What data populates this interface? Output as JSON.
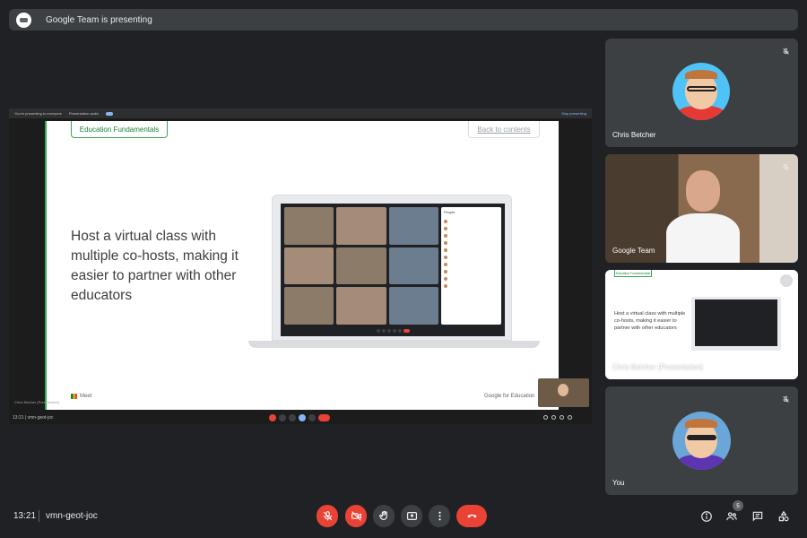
{
  "banner": {
    "text": "Google Team is presenting"
  },
  "stage": {
    "top_bar_left": "You're presenting to everyone",
    "top_bar_audio": "Presentation audio",
    "top_bar_stop": "Stop presenting",
    "caption": "Chris Betcher (Presentation)",
    "bottom_left": "13:21 | vmn-geot-joc"
  },
  "slide": {
    "pill": "Education Fundamentals",
    "back": "Back to contents",
    "heading": "Host a virtual class with multiple co-hosts, making it easier to partner with other educators",
    "meet_label": "Meet",
    "footer_brand": "Google for Education",
    "people_panel_title": "People"
  },
  "tiles": [
    {
      "name": "Chris Betcher"
    },
    {
      "name": "Google Team"
    },
    {
      "name": "Chris Betcher (Presentation)",
      "mini_pill": "Education Fundamentals",
      "mini_text": "Host a virtual class with multiple co-hosts, making it easier to partner with other educators"
    },
    {
      "name": "You"
    }
  ],
  "bottom": {
    "time": "13:21",
    "meeting_code": "vmn-geot-joc",
    "participant_count": "5"
  },
  "icons": {
    "mic": "mic-off-icon",
    "camera": "camera-off-icon",
    "hand": "raise-hand-icon",
    "present": "present-screen-icon",
    "more": "more-vert-icon",
    "end": "end-call-icon",
    "info": "info-icon",
    "people": "people-icon",
    "chat": "chat-icon",
    "activities": "activities-icon"
  },
  "colors": {
    "background": "#202124",
    "control": "#3c4043",
    "end_call": "#ea4335",
    "accent_green": "#34a853"
  }
}
